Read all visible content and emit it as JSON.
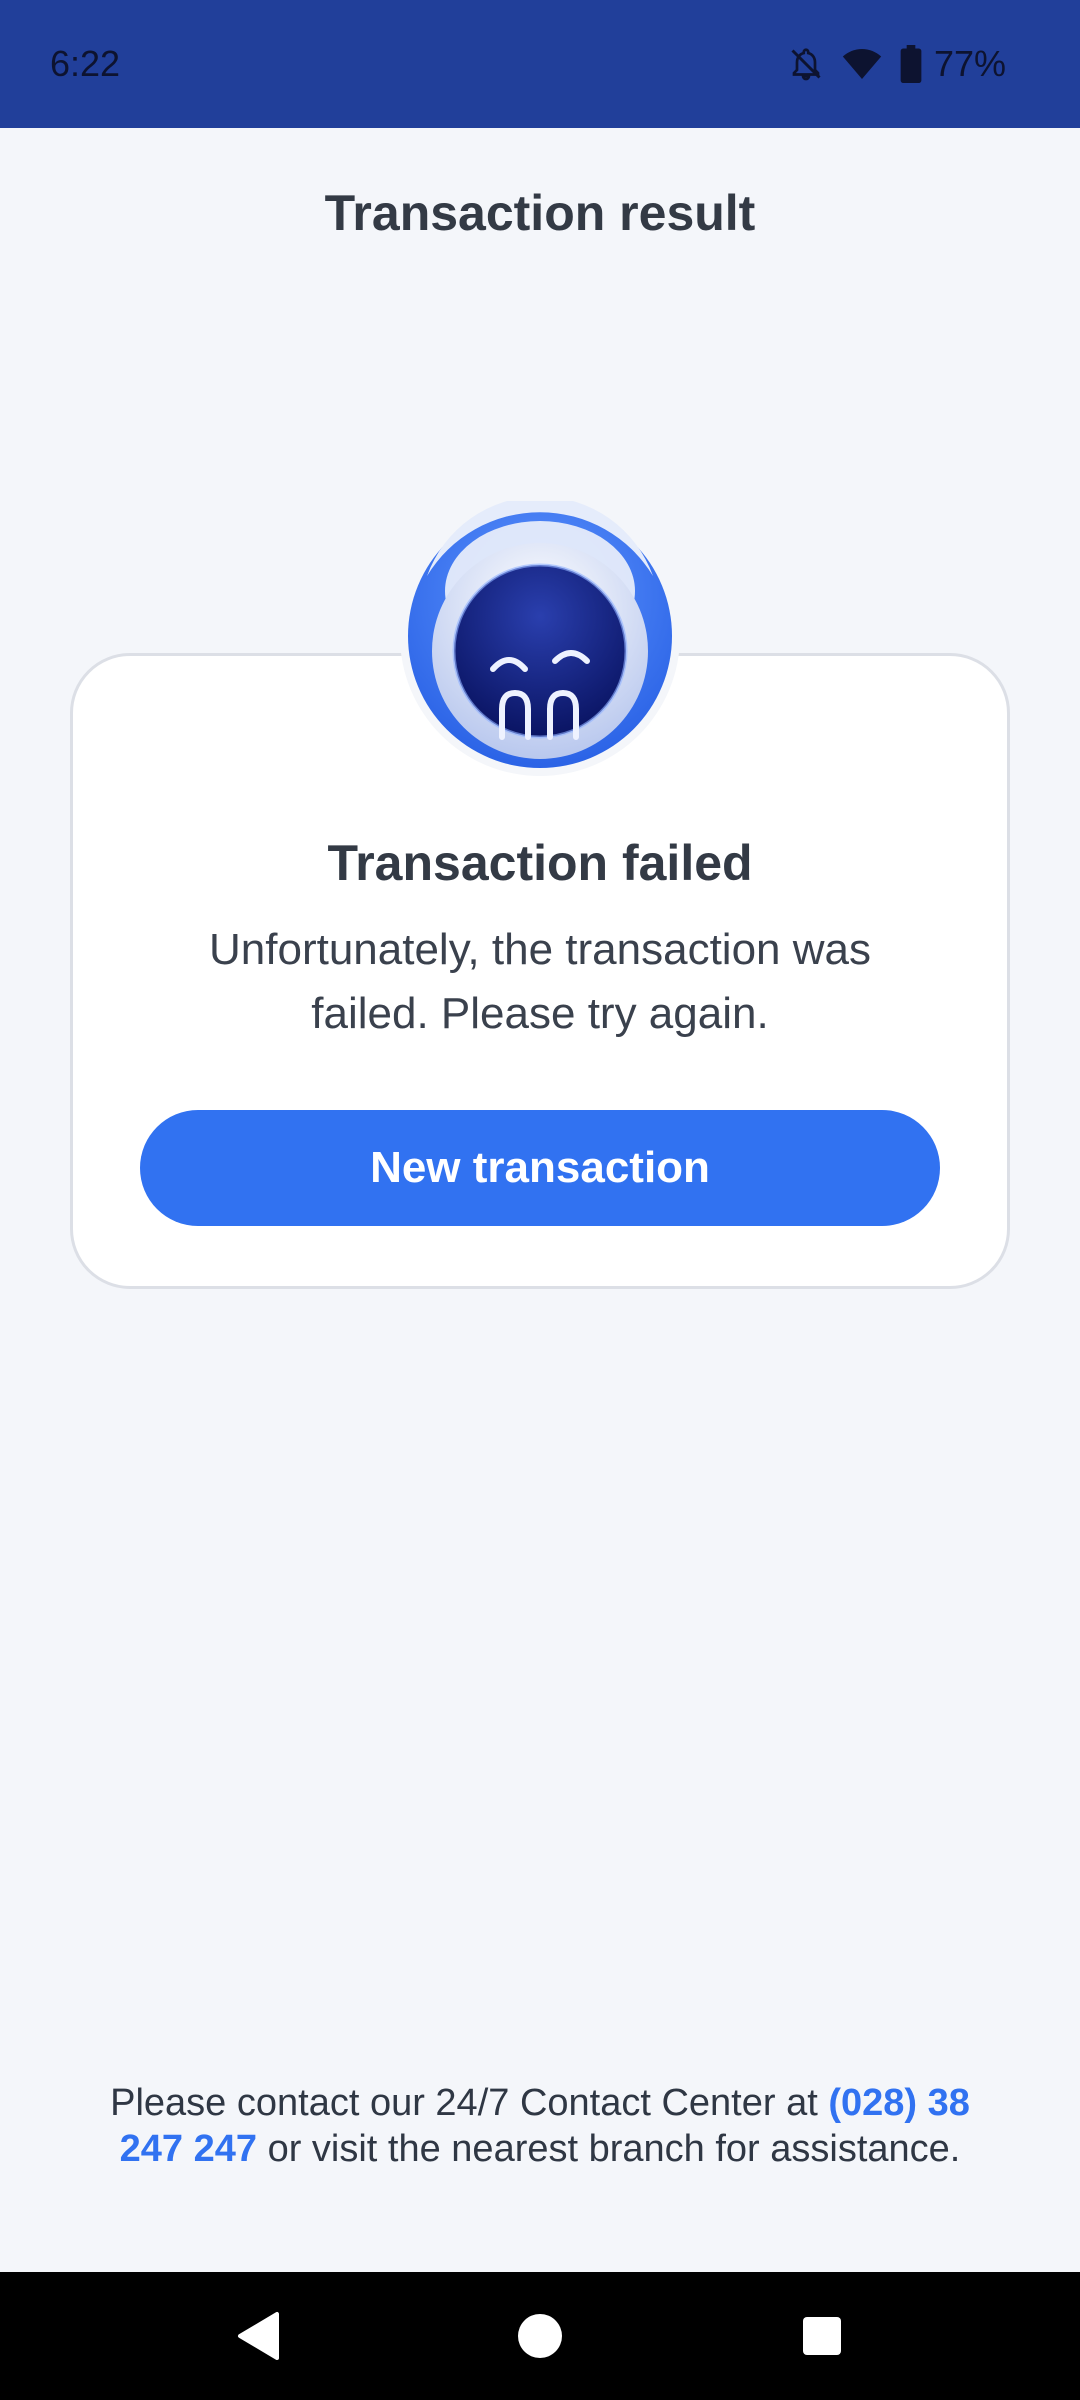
{
  "status_bar": {
    "time": "6:22",
    "battery": "77%",
    "icons": [
      "notifications-off-icon",
      "wifi-icon",
      "battery-icon"
    ]
  },
  "header": {
    "title": "Transaction result"
  },
  "result": {
    "mascot_icon": "sad-robot-mascot-icon",
    "title": "Transaction failed",
    "message": "Unfortunately, the transaction was failed. Please try again.",
    "button_label": "New transaction"
  },
  "help": {
    "text_before": "Please contact our 24/7 Contact Center at ",
    "phone": "(028) 38 247 247",
    "text_after": " or visit the nearest branch for assistance."
  },
  "nav_bar": {
    "buttons": [
      "back-icon",
      "home-icon",
      "recents-icon"
    ]
  },
  "colors": {
    "status_bar": "#213f9a",
    "background": "#f4f6fa",
    "accent": "#3172f1",
    "text": "#333a45"
  }
}
